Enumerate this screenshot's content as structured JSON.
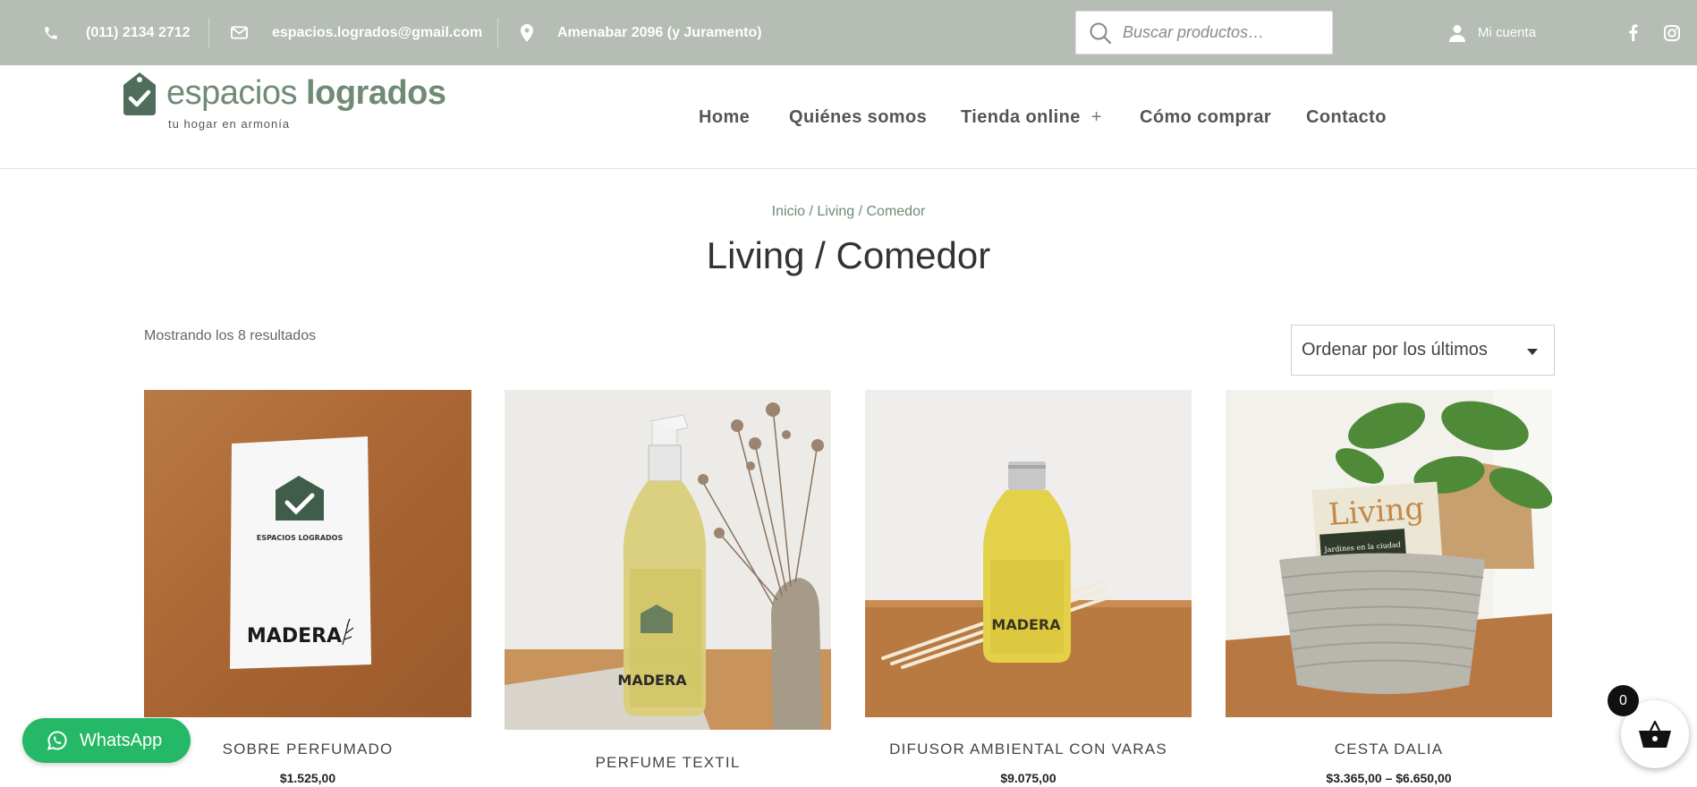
{
  "topbar": {
    "phone": "(011) 2134 2712",
    "email": "espacios.logrados@gmail.com",
    "address": "Amenabar 2096 (y Juramento)",
    "search_placeholder": "Buscar productos…",
    "account_label": "Mi cuenta",
    "icons": [
      "phone-icon",
      "envelope-icon",
      "map-pin-icon",
      "search-icon",
      "user-icon",
      "facebook-icon",
      "instagram-icon"
    ]
  },
  "header": {
    "logo_light": "espacios",
    "logo_bold": "logrados",
    "tagline": "tu hogar en armonía",
    "nav": [
      {
        "label": "Home"
      },
      {
        "label": "Quiénes somos"
      },
      {
        "label": "Tienda online",
        "plus": "+"
      },
      {
        "label": "Cómo comprar"
      },
      {
        "label": "Contacto"
      }
    ]
  },
  "content": {
    "breadcrumb": "Inicio / Living / Comedor",
    "title": "Living / Comedor",
    "results": "Mostrando los 8 resultados",
    "sort_selected": "Ordenar por los últimos"
  },
  "products": [
    {
      "name": "SOBRE PERFUMADO",
      "price": "$1.525,00"
    },
    {
      "name": "PERFUME TEXTIL",
      "price": ""
    },
    {
      "name": "DIFUSOR AMBIENTAL CON VARAS",
      "price": "$9.075,00"
    },
    {
      "name": "CESTA DALIA",
      "price": "$3.365,00 – $6.650,00"
    }
  ],
  "image_text": {
    "brand_label": "ESPACIOS LOGRADOS",
    "scent_label": "MADERA",
    "magazine_title": "Living",
    "magazine_subtitle": "Jardines en la ciudad"
  },
  "floating": {
    "whatsapp_label": "WhatsApp",
    "cart_count": "0"
  },
  "colors": {
    "topbar": "#b5bdb4",
    "brand_green": "#6f8b76",
    "whatsapp_green": "#25b866"
  }
}
